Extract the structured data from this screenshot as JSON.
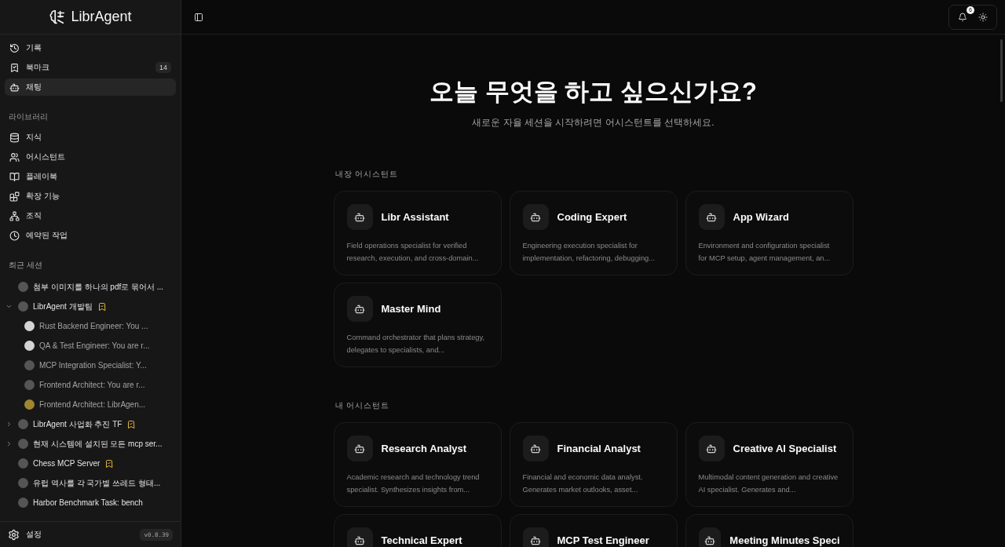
{
  "app": {
    "name": "LibrAgent",
    "version": "v0.8.39"
  },
  "nav": [
    {
      "label": "기록",
      "selected": false
    },
    {
      "label": "북마크",
      "selected": false,
      "badge": "14"
    },
    {
      "label": "채팅",
      "selected": true
    }
  ],
  "library": {
    "title": "라이브러리",
    "items": [
      {
        "label": "지식",
        "selected": false
      },
      {
        "label": "어시스턴트",
        "selected": false
      },
      {
        "label": "플레이북",
        "selected": false
      },
      {
        "label": "확장 기능",
        "selected": false
      },
      {
        "label": "조직",
        "selected": false
      },
      {
        "label": "예약된 작업",
        "selected": false
      }
    ]
  },
  "recent": {
    "title": "최근 세션",
    "sessions": [
      {
        "title": "첨부 이미지를 하나의 pdf로 묶어서 ...",
        "color": "#555555",
        "bookmarked": false
      },
      {
        "title": "LibrAgent 개발팀",
        "color": "#555555",
        "bookmarked": true,
        "expanded": true,
        "children": [
          {
            "title": "Rust Backend Engineer: You ...",
            "color": "#d4d4d4",
            "bookmarked": false
          },
          {
            "title": "QA & Test Engineer: You are r...",
            "color": "#d4d4d4",
            "bookmarked": false
          },
          {
            "title": "MCP Integration Specialist: Y...",
            "color": "#555555",
            "bookmarked": false
          },
          {
            "title": "Frontend Architect: You are r...",
            "color": "#555555",
            "bookmarked": false
          },
          {
            "title": "Frontend Architect: LibrAgen...",
            "color": "#a08630",
            "bookmarked": false
          }
        ]
      },
      {
        "title": "LibrAgent 사업화 추진 TF",
        "color": "#555555",
        "bookmarked": true,
        "expanded": false
      },
      {
        "title": "현재 시스템에 설치된 모든 mcp ser...",
        "color": "#555555",
        "bookmarked": false,
        "expanded": false
      },
      {
        "title": "Chess MCP Server",
        "color": "#555555",
        "bookmarked": true
      },
      {
        "title": "유럽 역사를 각 국가별 쓰레드 형태...",
        "color": "#555555",
        "bookmarked": false
      },
      {
        "title": "Harbor Benchmark Task: bench",
        "color": "#555555",
        "bookmarked": false
      }
    ]
  },
  "settings": {
    "label": "설정"
  },
  "header": {
    "notifications": "6"
  },
  "hero": {
    "title": "오늘 무엇을 하고 싶으신가요?",
    "subtitle": "새로운 자율 세션을 시작하려면 어시스턴트를 선택하세요."
  },
  "sections": [
    {
      "title": "내장 어시스턴트",
      "assistants": [
        {
          "name": "Libr Assistant",
          "description": "Field operations specialist for verified research, execution, and cross-domain..."
        },
        {
          "name": "Coding Expert",
          "description": "Engineering execution specialist for implementation, refactoring, debugging..."
        },
        {
          "name": "App Wizard",
          "description": "Environment and configuration specialist for MCP setup, agent management, an..."
        },
        {
          "name": "Master Mind",
          "description": "Command orchestrator that plans strategy, delegates to specialists, and..."
        }
      ]
    },
    {
      "title": "내 어시스턴트",
      "assistants": [
        {
          "name": "Research Analyst",
          "description": "Academic research and technology trend specialist. Synthesizes insights from..."
        },
        {
          "name": "Financial Analyst",
          "description": "Financial and economic data analyst. Generates market outlooks, asset..."
        },
        {
          "name": "Creative AI Specialist",
          "description": "Multimodal content generation and creative AI specialist. Generates and..."
        },
        {
          "name": "Technical Expert"
        },
        {
          "name": "MCP Test Engineer"
        },
        {
          "name": "Meeting Minutes Speci"
        }
      ]
    }
  ]
}
